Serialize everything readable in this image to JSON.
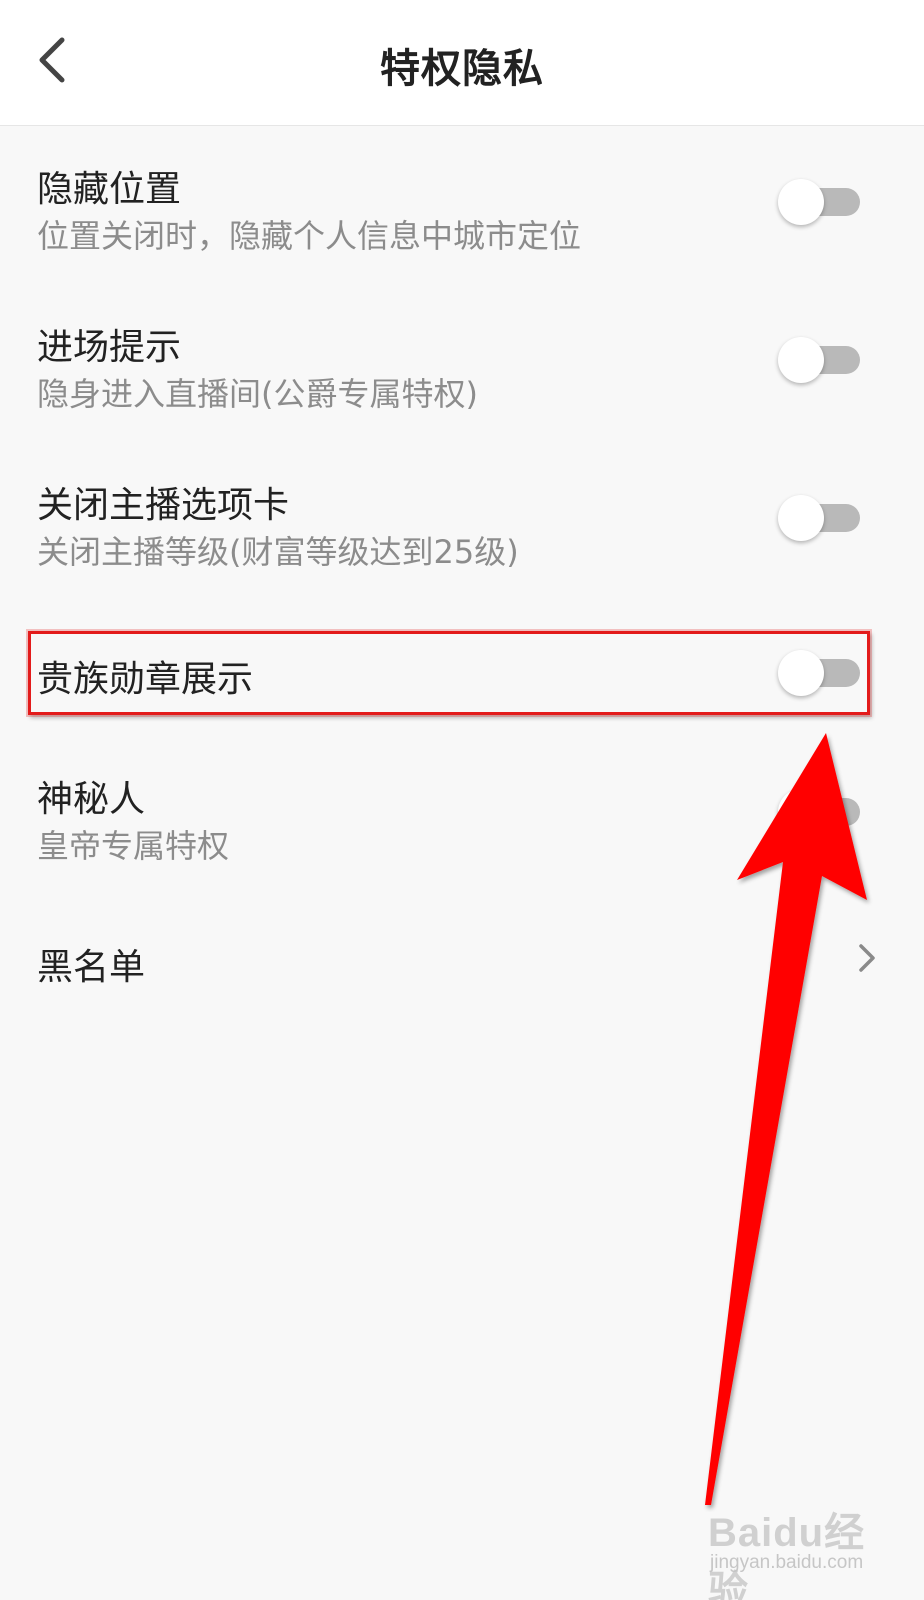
{
  "header": {
    "title": "特权隐私",
    "back_icon": "chevron-left-icon"
  },
  "settings": {
    "items": [
      {
        "title": "隐藏位置",
        "subtitle": "位置关闭时，隐藏个人信息中城市定位",
        "toggle_on": false
      },
      {
        "title": "进场提示",
        "subtitle": "隐身进入直播间(公爵专属特权)",
        "toggle_on": false
      },
      {
        "title": "关闭主播选项卡",
        "subtitle": "关闭主播等级(财富等级达到25级)",
        "toggle_on": false
      },
      {
        "title": "贵族勋章展示",
        "toggle_on": false,
        "highlighted": true
      },
      {
        "title": "神秘人",
        "subtitle": "皇帝专属特权",
        "toggle_on": false
      }
    ],
    "blacklist": {
      "title": "黑名单",
      "icon": "chevron-right-icon"
    }
  },
  "annotation": {
    "highlight_color": "#e31b1b",
    "arrow_color": "#ff0000"
  },
  "watermark": {
    "brand": "Baidu经验",
    "site": "jingyan.baidu.com"
  }
}
